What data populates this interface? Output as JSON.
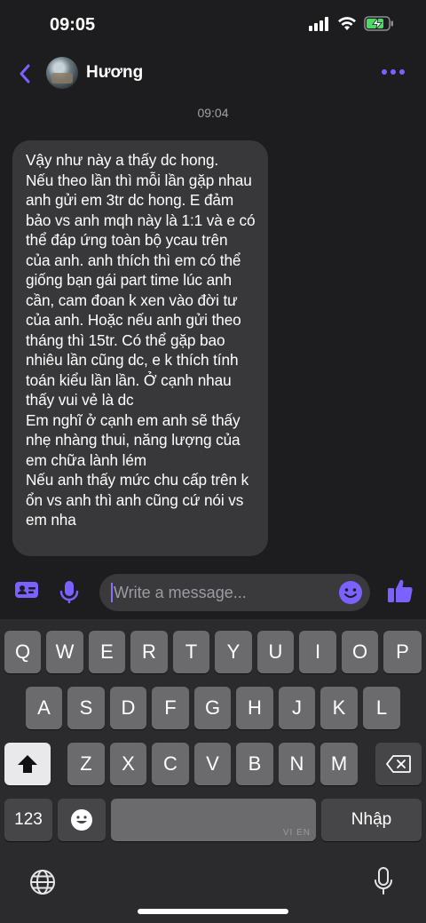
{
  "status_bar": {
    "time": "09:05",
    "signal_icon": "cellular-signal-icon",
    "wifi_icon": "wifi-icon",
    "battery_icon": "battery-charging-icon",
    "battery_color": "#4cd964"
  },
  "header": {
    "contact_name": "Hương",
    "accent_color": "#7b61ff"
  },
  "conversation": {
    "timestamp": "09:04",
    "message_text": "Vậy như này a thấy dc hong.\nNếu theo lần thì mỗi lần gặp nhau anh gửi em 3tr dc hong. E đảm bảo vs anh mqh này là 1:1 và e có thể đáp ứng toàn bộ ycau trên của anh. anh thích thì em có thể giống bạn gái part time lúc anh cần, cam đoan k xen vào đời tư của anh. Hoặc nếu anh gửi theo tháng thì 15tr. Có thể gặp bao nhiêu lần cũng dc, e k thích tính toán kiểu lần lần. Ở cạnh nhau thấy vui vẻ là dc\nEm nghĩ ở cạnh em anh sẽ thấy nhẹ nhàng thui, năng lượng của em chữa lành lém\nNếu anh thấy mức chu cấp trên k ổn vs anh thì anh cũng cứ nói vs em nha"
  },
  "composer": {
    "placeholder": "Write a message...",
    "value": ""
  },
  "keyboard": {
    "row1": [
      "Q",
      "W",
      "E",
      "R",
      "T",
      "Y",
      "U",
      "I",
      "O",
      "P"
    ],
    "row2": [
      "A",
      "S",
      "D",
      "F",
      "G",
      "H",
      "J",
      "K",
      "L"
    ],
    "row3": [
      "Z",
      "X",
      "C",
      "V",
      "B",
      "N",
      "M"
    ],
    "numbers_key": "123",
    "return_key": "Nhập",
    "space_label": "VI EN"
  }
}
